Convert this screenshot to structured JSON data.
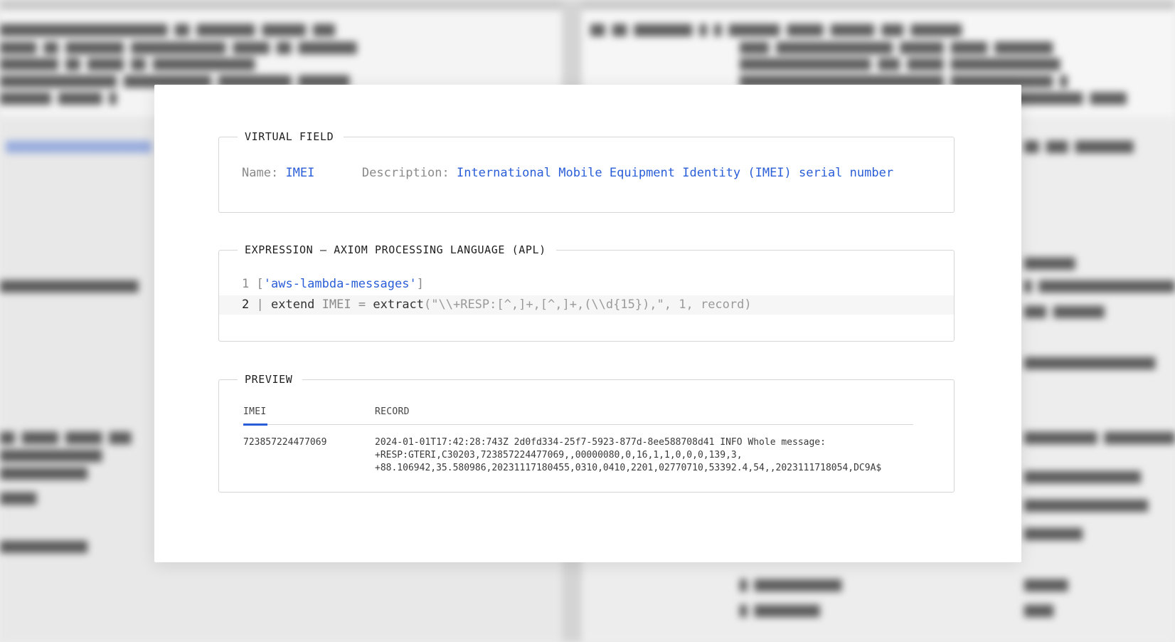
{
  "virtual_field": {
    "legend": "VIRTUAL FIELD",
    "name_label": "Name:",
    "name_value": "IMEI",
    "description_label": "Description:",
    "description_value": "International Mobile Equipment Identity (IMEI) serial number"
  },
  "expression": {
    "legend": "EXPRESSION — AXIOM PROCESSING LANGUAGE (APL)",
    "lines": [
      {
        "number": "1",
        "open": "[",
        "string": "'aws-lambda-messages'",
        "close": "]"
      },
      {
        "number": "2",
        "pipe": "|",
        "keyword": "extend",
        "field": "IMEI",
        "equals": "=",
        "function": "extract",
        "args": "(\"\\\\+RESP:[^,]+,[^,]+,(\\\\d{15}),\", 1, record)"
      }
    ]
  },
  "preview": {
    "legend": "PREVIEW",
    "columns": [
      "IMEI",
      "RECORD"
    ],
    "rows": [
      {
        "imei": "723857224477069",
        "record_lines": [
          "2024-01-01T17:42:28:743Z 2d0fd334-25f7-5923-877d-8ee588708d41 INFO Whole message:",
          "+RESP:GTERI,C30203,723857224477069,,00000080,0,16,1,1,0,0,0,139,3,",
          "+88.106942,35.580986,20231117180455,0310,0410,2201,02770710,53392.4,54,,2023111718054,DC9A$"
        ]
      }
    ]
  },
  "colors": {
    "accent": "#2a5ed8",
    "muted": "#8a8a8a",
    "border": "#d6d6d6"
  }
}
